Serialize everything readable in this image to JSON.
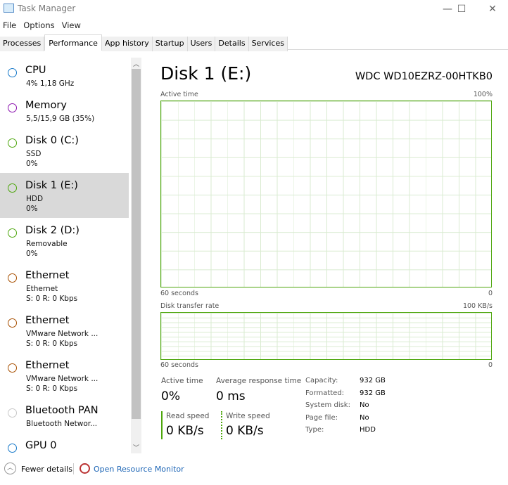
{
  "window": {
    "title": "Task Manager",
    "minimize": "—",
    "maximize": "☐",
    "close": "✕"
  },
  "menu": [
    "File",
    "Options",
    "View"
  ],
  "tabs": [
    "Processes",
    "Performance",
    "App history",
    "Startup",
    "Users",
    "Details",
    "Services"
  ],
  "sidebar": [
    {
      "name": "CPU",
      "sub1": "4% 1,18 GHz",
      "sub2": "",
      "color": "#1779c9"
    },
    {
      "name": "Memory",
      "sub1": "5,5/15,9 GB (35%)",
      "sub2": "",
      "color": "#8b12ae"
    },
    {
      "name": "Disk 0 (C:)",
      "sub1": "SSD",
      "sub2": "0%",
      "color": "#4da60c"
    },
    {
      "name": "Disk 1 (E:)",
      "sub1": "HDD",
      "sub2": "0%",
      "color": "#4da60c"
    },
    {
      "name": "Disk 2 (D:)",
      "sub1": "Removable",
      "sub2": "0%",
      "color": "#4da60c"
    },
    {
      "name": "Ethernet",
      "sub1": "Ethernet",
      "sub2": "S: 0 R: 0 Kbps",
      "color": "#a74f01"
    },
    {
      "name": "Ethernet",
      "sub1": "VMware Network ...",
      "sub2": "S: 0 R: 0 Kbps",
      "color": "#a74f01"
    },
    {
      "name": "Ethernet",
      "sub1": "VMware Network ...",
      "sub2": "S: 0 R: 0 Kbps",
      "color": "#a74f01"
    },
    {
      "name": "Bluetooth PAN",
      "sub1": "Bluetooth Networ...",
      "sub2": "",
      "color": "#c8c8c8"
    },
    {
      "name": "GPU 0",
      "sub1": "",
      "sub2": "",
      "color": "#1779c9"
    }
  ],
  "main": {
    "title": "Disk 1 (E:)",
    "model": "WDC WD10EZRZ-00HTKB0",
    "g1": {
      "label": "Active time",
      "max": "100%",
      "time": "60 seconds",
      "min": "0"
    },
    "g2": {
      "label": "Disk transfer rate",
      "max": "100 KB/s",
      "time": "60 seconds",
      "min": "0"
    },
    "stats": {
      "active_label": "Active time",
      "active": "0%",
      "resp_label": "Average response time",
      "resp": "0 ms",
      "read_label": "Read speed",
      "read": "0 KB/s",
      "write_label": "Write speed",
      "write": "0 KB/s"
    },
    "details": [
      [
        "Capacity:",
        "932 GB"
      ],
      [
        "Formatted:",
        "932 GB"
      ],
      [
        "System disk:",
        "No"
      ],
      [
        "Page file:",
        "No"
      ],
      [
        "Type:",
        "HDD"
      ]
    ]
  },
  "footer": {
    "fewer": "Fewer details",
    "monitor": "Open Resource Monitor"
  }
}
